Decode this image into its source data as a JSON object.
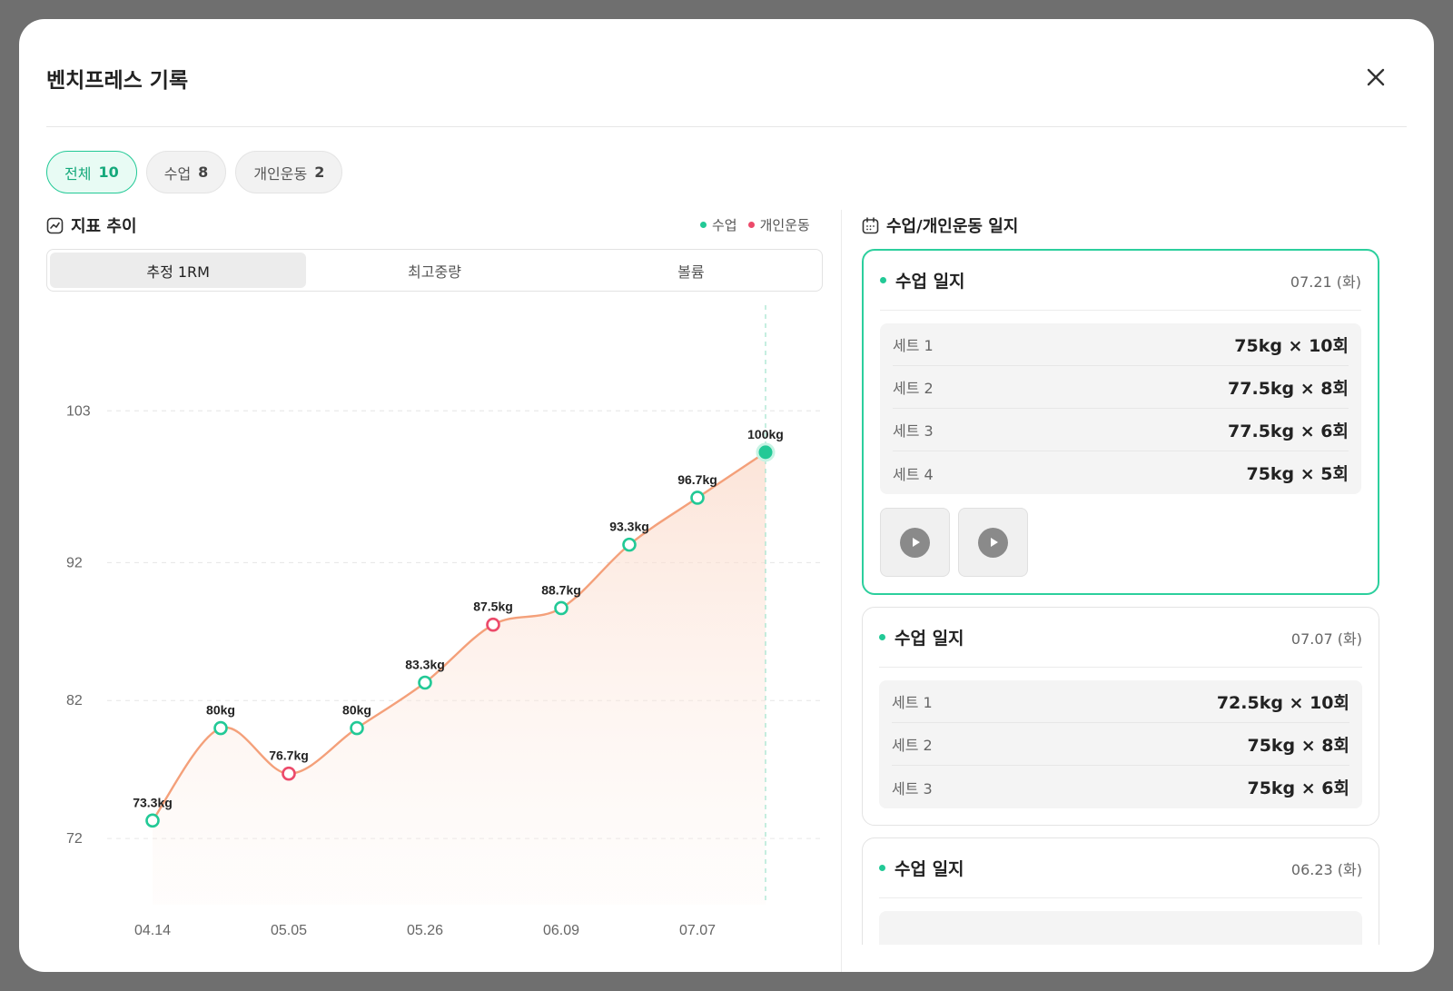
{
  "modal": {
    "title": "벤치프레스 기록"
  },
  "filters": [
    {
      "label": "전체",
      "count": "10",
      "active": true
    },
    {
      "label": "수업",
      "count": "8",
      "active": false
    },
    {
      "label": "개인운동",
      "count": "2",
      "active": false
    }
  ],
  "trend": {
    "title": "지표 추이",
    "legend": [
      {
        "label": "수업",
        "color": "#22c996"
      },
      {
        "label": "개인운동",
        "color": "#ec4a6a"
      }
    ],
    "tabs": [
      "추정 1RM",
      "최고중량",
      "볼륨"
    ],
    "active_tab": 0
  },
  "chart_data": {
    "type": "line",
    "ylim": [
      67.2,
      110
    ],
    "yticks": [
      72,
      82,
      92,
      103
    ],
    "x_ticks": [
      "04.14",
      "05.05",
      "05.26",
      "06.09",
      "07.07"
    ],
    "x_tick_index": [
      0,
      2,
      4,
      6,
      8
    ],
    "points": [
      {
        "value": 73.3,
        "label": "73.3kg",
        "kind": "class"
      },
      {
        "value": 80,
        "label": "80kg",
        "kind": "class"
      },
      {
        "value": 76.7,
        "label": "76.7kg",
        "kind": "personal"
      },
      {
        "value": 80,
        "label": "80kg",
        "kind": "class"
      },
      {
        "value": 83.3,
        "label": "83.3kg",
        "kind": "class"
      },
      {
        "value": 87.5,
        "label": "87.5kg",
        "kind": "personal"
      },
      {
        "value": 88.7,
        "label": "88.7kg",
        "kind": "class"
      },
      {
        "value": 93.3,
        "label": "93.3kg",
        "kind": "class"
      },
      {
        "value": 96.7,
        "label": "96.7kg",
        "kind": "class"
      },
      {
        "value": 100,
        "label": "100kg",
        "kind": "class",
        "selected": true
      }
    ],
    "colors": {
      "line": "#f4a07a",
      "class": "#22c996",
      "personal": "#ec4a6a"
    },
    "grid": true
  },
  "journal": {
    "title": "수업/개인운동 일지",
    "cards": [
      {
        "title": "수업 일지",
        "date": "07.21 (화)",
        "active": true,
        "sets": [
          {
            "name": "세트 1",
            "value": "75kg × 10회"
          },
          {
            "name": "세트 2",
            "value": "77.5kg × 8회"
          },
          {
            "name": "세트 3",
            "value": "77.5kg × 6회"
          },
          {
            "name": "세트 4",
            "value": "75kg × 5회"
          }
        ],
        "videos": 2
      },
      {
        "title": "수업 일지",
        "date": "07.07 (화)",
        "active": false,
        "sets": [
          {
            "name": "세트 1",
            "value": "72.5kg × 10회"
          },
          {
            "name": "세트 2",
            "value": "75kg × 8회"
          },
          {
            "name": "세트 3",
            "value": "75kg × 6회"
          }
        ],
        "videos": 0
      },
      {
        "title": "수업 일지",
        "date": "06.23 (화)",
        "active": false,
        "sets": [],
        "videos": 0
      }
    ]
  }
}
